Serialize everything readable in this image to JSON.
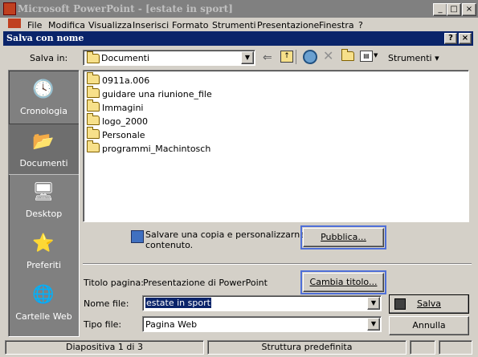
{
  "app": {
    "title": "Microsoft PowerPoint - [estate in sport]",
    "menu": [
      "File",
      "Modifica",
      "Visualizza",
      "Inserisci",
      "Formato",
      "Strumenti",
      "Presentazione",
      "Finestra",
      "?"
    ]
  },
  "dialog": {
    "title": "Salva con nome",
    "help": "?",
    "close": "×",
    "save_in_label": "Salva in:",
    "save_in_value": "Documenti",
    "tools_label": "Strumenti"
  },
  "places": [
    {
      "label": "Cronologia"
    },
    {
      "label": "Documenti"
    },
    {
      "label": "Desktop"
    },
    {
      "label": "Preferiti"
    },
    {
      "label": "Cartelle Web"
    }
  ],
  "files": [
    "0911a.006",
    "guidare una riunione_file",
    "Immagini",
    "logo_2000",
    "Personale",
    "programmi_Machintosch"
  ],
  "publish": {
    "text_line1": "Salvare una copia e personalizzarne il",
    "text_line2": "contenuto.",
    "button": "Pubblica..."
  },
  "page_title": {
    "label": "Titolo pagina:",
    "value": "Presentazione di PowerPoint",
    "change_button": "Cambia titolo..."
  },
  "file_name": {
    "label": "Nome file:",
    "value": "estate in sport"
  },
  "file_type": {
    "label": "Tipo file:",
    "value": "Pagina Web"
  },
  "buttons": {
    "save": "Salva",
    "cancel": "Annulla"
  },
  "status": {
    "slide": "Diapositiva 1 di 3",
    "design": "Struttura predefinita"
  }
}
